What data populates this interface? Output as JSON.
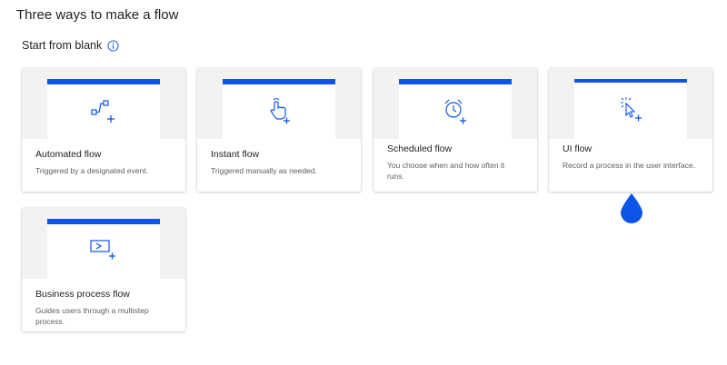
{
  "page": {
    "title": "Three ways to make a flow"
  },
  "section": {
    "label": "Start from blank"
  },
  "cards": [
    {
      "title": "Automated flow",
      "description": "Triggered by a designated event."
    },
    {
      "title": "Instant flow",
      "description": "Triggered manually as needed."
    },
    {
      "title": "Scheduled flow",
      "description": "You choose when and how often it runs."
    },
    {
      "title": "UI flow",
      "description": "Record a process in the user interface."
    },
    {
      "title": "Business process flow",
      "description": "Guides users through a multistep process."
    }
  ],
  "colors": {
    "accent": "#0f54e8",
    "card_bg": "#f3f2f1",
    "title_text": "#201f1e",
    "desc_text": "#605e5c"
  },
  "icons": [
    "info-icon",
    "automated-flow-icon",
    "instant-flow-icon",
    "scheduled-flow-icon",
    "ui-flow-icon",
    "business-process-flow-icon",
    "cursor-drop-marker"
  ]
}
